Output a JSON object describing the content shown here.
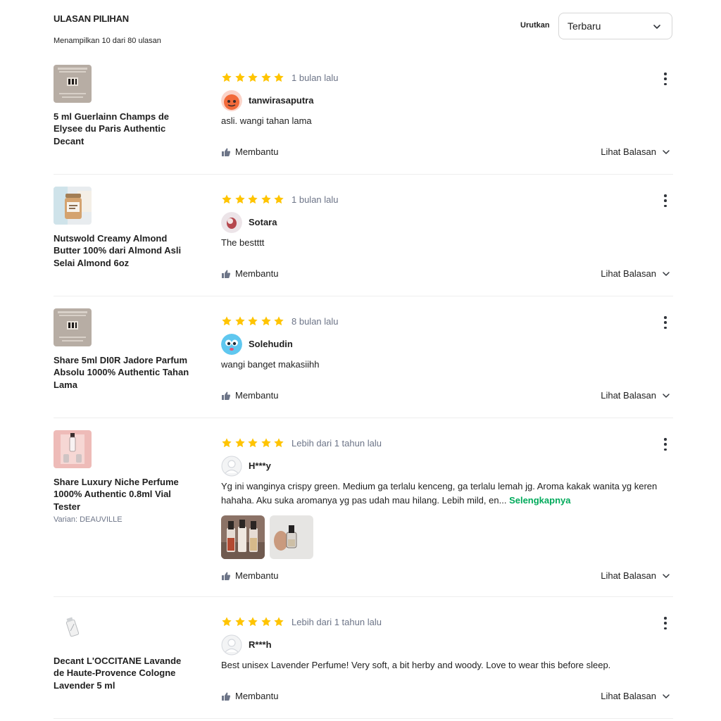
{
  "header": {
    "title": "ULASAN PILIHAN",
    "subtitle": "Menampilkan 10 dari 80 ulasan",
    "sort_label": "Urutkan",
    "sort_value": "Terbaru"
  },
  "colors": {
    "star": "#ffc400",
    "accent_green": "#00aa5b",
    "muted_text": "#6d7588",
    "divider": "#eeeeee"
  },
  "reviews": [
    {
      "product": "5 ml Guerlainn Champs de Elysee du Paris Authentic Decant",
      "variant": "",
      "rating": 5,
      "time": "1 bulan lalu",
      "user": "tanwirasaputra",
      "text": "asli. wangi tahan lama",
      "more": "",
      "helpful": "Membantu",
      "reply": "Lihat Balasan",
      "thumb_icon": "perfume-decant-thumb",
      "avatar_icon": "orange-face-avatar"
    },
    {
      "product": "Nutswold Creamy Almond Butter 100% dari Almond Asli Selai Almond 6oz",
      "variant": "",
      "rating": 5,
      "time": "1 bulan lalu",
      "user": "Sotara",
      "text": "The bestttt",
      "more": "",
      "helpful": "Membantu",
      "reply": "Lihat Balasan",
      "thumb_icon": "almond-butter-jar-thumb",
      "avatar_icon": "photo-avatar"
    },
    {
      "product": "Share 5ml DI0R Jadore Parfum Absolu 1000% Authentic Tahan Lama",
      "variant": "",
      "rating": 5,
      "time": "8 bulan lalu",
      "user": "Solehudin",
      "text": "wangi banget makasiihh",
      "more": "",
      "helpful": "Membantu",
      "reply": "Lihat Balasan",
      "thumb_icon": "perfume-decant-thumb",
      "avatar_icon": "blue-face-avatar"
    },
    {
      "product": "Share Luxury Niche Perfume 1000% Authentic 0.8ml Vial Tester",
      "variant": "Varian: DEAUVILLE",
      "rating": 5,
      "time": "Lebih dari 1 tahun lalu",
      "user": "H***y",
      "text": "Yg ini wanginya crispy green. Medium ga terlalu kenceng, ga terlalu lemah jg. Aroma kakak wanita yg keren hahaha. Aku suka aromanya yg pas udah mau hilang. Lebih mild, en...",
      "more": "Selengkapnya",
      "helpful": "Membantu",
      "reply": "Lihat Balasan",
      "thumb_icon": "vial-tester-thumb",
      "avatar_icon": "default-user-avatar"
    },
    {
      "product": "Decant L'OCCITANE Lavande de Haute-Provence Cologne Lavender 5 ml",
      "variant": "",
      "rating": 5,
      "time": "Lebih dari 1 tahun lalu",
      "user": "R***h",
      "text": "Best unisex Lavender Perfume! Very soft, a bit herby and woody. Love to wear this before sleep.",
      "more": "",
      "helpful": "Membantu",
      "reply": "Lihat Balasan",
      "thumb_icon": "decant-vial-thumb",
      "avatar_icon": "default-user-avatar"
    }
  ]
}
